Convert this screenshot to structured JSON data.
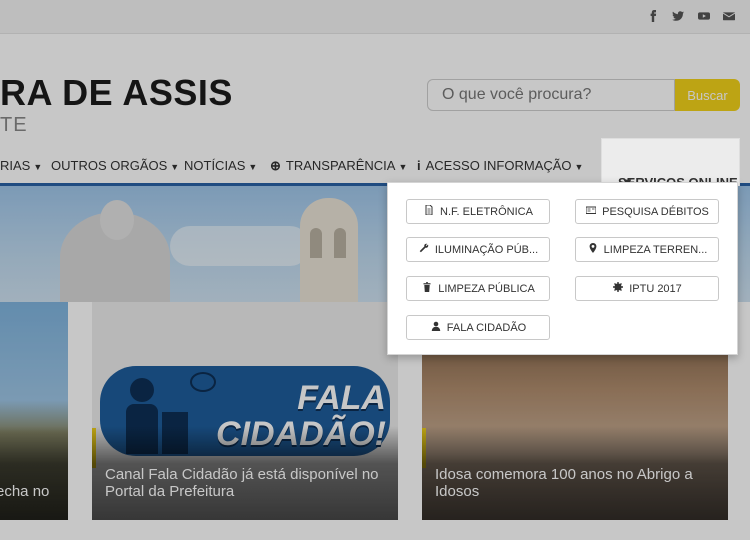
{
  "social": {
    "icons": [
      "facebook-icon",
      "twitter-icon",
      "youtube-icon",
      "mail-icon"
    ]
  },
  "header": {
    "title": "RA DE ASSIS",
    "subtitle": "TE",
    "search_placeholder": "O que você procura?",
    "search_button": "Buscar"
  },
  "nav": {
    "items": [
      {
        "label": "RIAS"
      },
      {
        "label": "OUTROS ORGÃOS"
      },
      {
        "label": "NOTÍCIAS"
      },
      {
        "label": "TRANSPARÊNCIA",
        "icon": "zoom-icon"
      },
      {
        "label": "ACESSO INFORMAÇÃO",
        "icon": "info-icon"
      }
    ],
    "active": "SERVIÇOS ONLINE"
  },
  "dropdown": {
    "items": [
      {
        "label": "N.F. ELETRÔNICA",
        "icon": "document-icon"
      },
      {
        "label": "PESQUISA DÉBITOS",
        "icon": "card-icon"
      },
      {
        "label": "ILUMINAÇÃO PÚB...",
        "icon": "wrench-icon"
      },
      {
        "label": "LIMPEZA TERREN...",
        "icon": "map-marker-icon"
      },
      {
        "label": "LIMPEZA PÚBLICA",
        "icon": "trash-icon"
      },
      {
        "label": "IPTU 2017",
        "icon": "gear-icon"
      },
      {
        "label": "FALA CIDADÃO",
        "icon": "user-icon"
      }
    ]
  },
  "cards": [
    {
      "caption": "echa no"
    },
    {
      "caption": "Canal Fala Cidadão já está disponível no Portal da Prefeitura",
      "image_text": "FALA CIDADÃO!"
    },
    {
      "caption": "Idosa comemora 100 anos no Abrigo a Idosos"
    }
  ],
  "colors": {
    "accent_yellow": "#f2d21a",
    "nav_border_blue": "#2a62a6",
    "fala_blue": "#1e5d9c"
  }
}
